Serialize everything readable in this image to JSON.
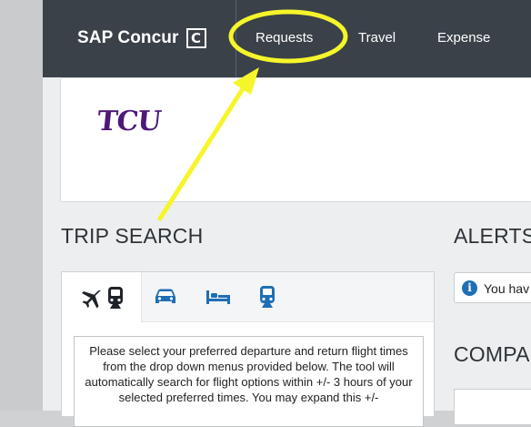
{
  "header": {
    "brand": "SAP Concur",
    "brand_logo_letter": "C",
    "nav": [
      {
        "label": "Requests"
      },
      {
        "label": "Travel"
      },
      {
        "label": "Expense"
      }
    ]
  },
  "banner": {
    "logo_text": "TCU",
    "logo_color": "#4d1979"
  },
  "trip_search": {
    "title": "TRIP SEARCH",
    "tabs": [
      {
        "icon": "airplane-icon",
        "selected": true
      },
      {
        "icon": "train-icon"
      },
      {
        "icon": "car-icon"
      },
      {
        "icon": "hotel-icon"
      },
      {
        "icon": "train-icon"
      }
    ],
    "info_text": "Please select your preferred departure and return flight times from the drop down menus provided below. The tool will automatically search for flight options within +/- 3 hours of your selected preferred times. You may expand this +/-"
  },
  "alerts": {
    "title": "ALERTS",
    "message": "You hav"
  },
  "company": {
    "title": "COMPA"
  },
  "colors": {
    "topbar": "#3a4149",
    "accent_blue": "#1f6fb5",
    "highlight": "#f5f52a"
  }
}
